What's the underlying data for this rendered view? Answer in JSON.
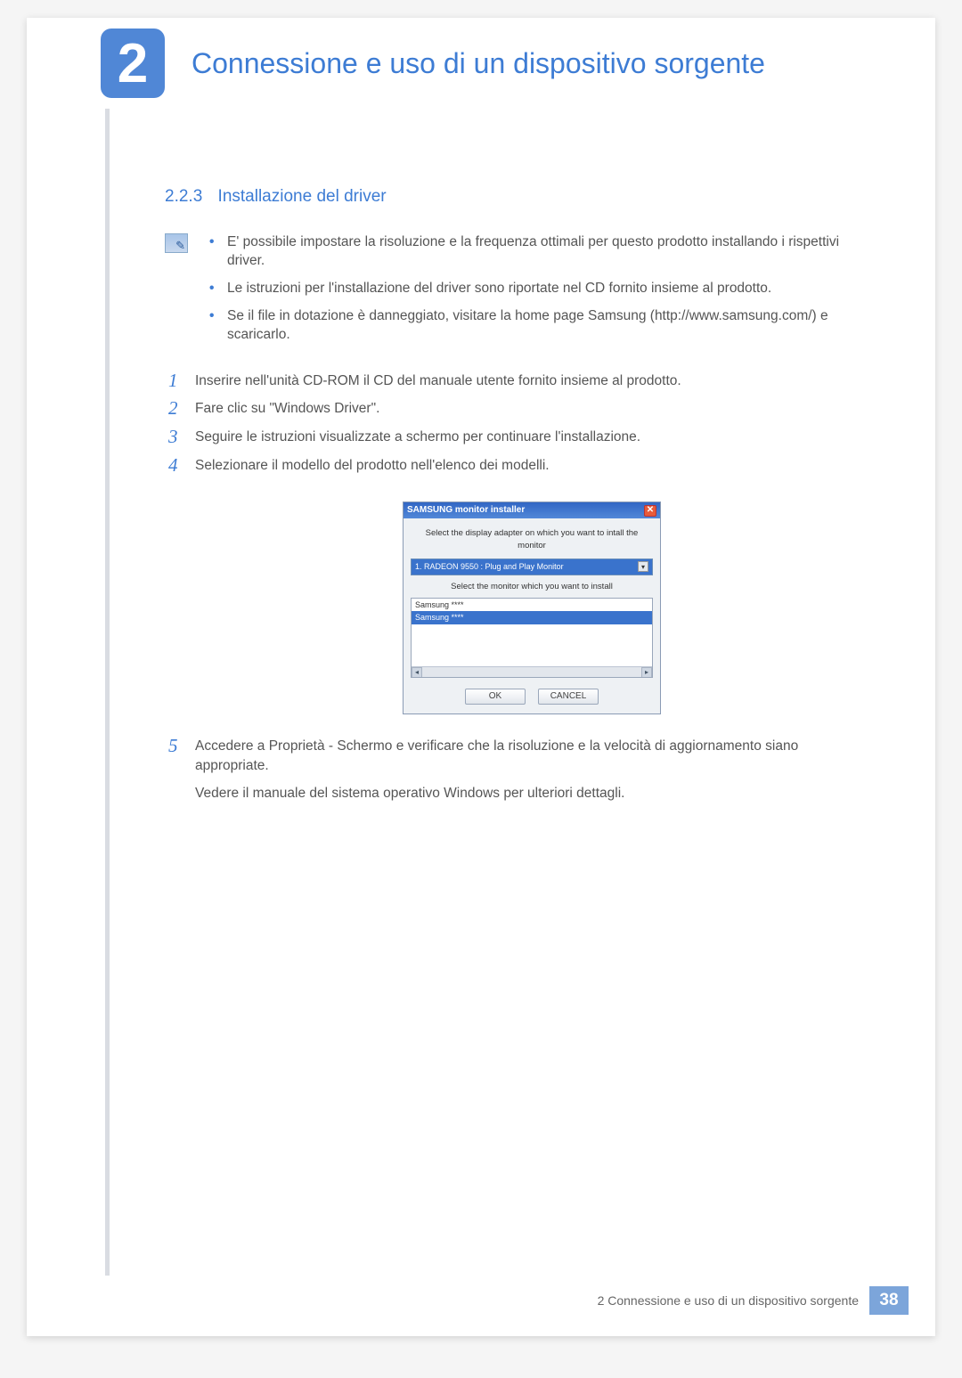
{
  "header": {
    "chapter_number": "2",
    "chapter_title": "Connessione e uso di un dispositivo sorgente"
  },
  "section": {
    "number": "2.2.3",
    "title": "Installazione del driver"
  },
  "notes": [
    "E' possibile impostare la risoluzione e la frequenza ottimali per questo prodotto installando i rispettivi driver.",
    "Le istruzioni per l'installazione del driver sono riportate nel CD fornito insieme al prodotto.",
    "Se il file in dotazione è danneggiato, visitare la home page Samsung (http://www.samsung.com/) e scaricarlo."
  ],
  "steps": {
    "s1": "Inserire nell'unità CD-ROM il CD del manuale utente fornito insieme al prodotto.",
    "s2": "Fare clic su \"Windows Driver\".",
    "s3": "Seguire le istruzioni visualizzate a schermo per continuare l'installazione.",
    "s4": "Selezionare il modello del prodotto nell'elenco dei modelli.",
    "s5": "Accedere a Proprietà - Schermo e verificare che la risoluzione e la velocità di aggiornamento siano appropriate.",
    "s5_extra": "Vedere il manuale del sistema operativo Windows per ulteriori dettagli."
  },
  "installer": {
    "title": "SAMSUNG monitor installer",
    "line1": "Select the display adapter on which you want to intall the monitor",
    "adapter": "1. RADEON 9550 : Plug and Play Monitor",
    "line2": "Select the monitor which you want to install",
    "list_item1": "Samsung ****",
    "list_item2": "Samsung ****",
    "ok": "OK",
    "cancel": "CANCEL"
  },
  "footer": {
    "text": "2 Connessione e uso di un dispositivo sorgente",
    "page": "38"
  }
}
